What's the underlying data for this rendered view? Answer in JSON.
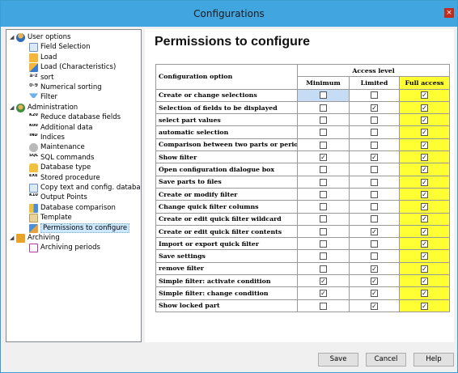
{
  "window": {
    "title": "Configurations",
    "close_label": "×"
  },
  "tree": {
    "items": [
      {
        "label": "User options",
        "icon": "user-icon",
        "cls": "user",
        "level": 1,
        "expander": "◢"
      },
      {
        "label": "Field Selection",
        "icon": "field-selection-icon",
        "cls": "grid",
        "level": 2
      },
      {
        "label": "Load",
        "icon": "load-icon",
        "cls": "load",
        "level": 2
      },
      {
        "label": "Load (Characteristics)",
        "icon": "load-characteristics-icon",
        "cls": "load2",
        "level": 2
      },
      {
        "label": "sort",
        "icon": "sort-icon",
        "cls": "sort",
        "level": 2,
        "glyph": "a-z"
      },
      {
        "label": "Numerical sorting",
        "icon": "numerical-sort-icon",
        "cls": "sort",
        "level": 2,
        "glyph": "0-9"
      },
      {
        "label": "Filter",
        "icon": "filter-icon",
        "cls": "filter",
        "level": 2
      },
      {
        "label": "Administration",
        "icon": "administration-icon",
        "cls": "admin",
        "level": 1,
        "expander": "◢"
      },
      {
        "label": "Reduce database fields",
        "icon": "reduce-fields-icon",
        "cls": "txt",
        "level": 2,
        "glyph": "K2011 K2111"
      },
      {
        "label": "Additional data",
        "icon": "additional-data-icon",
        "cls": "txt",
        "level": 2,
        "glyph": "K0009 K0011"
      },
      {
        "label": "Indices",
        "icon": "indices-icon",
        "cls": "txt",
        "level": 2,
        "glyph": "IND"
      },
      {
        "label": "Maintenance",
        "icon": "maintenance-icon",
        "cls": "maint",
        "level": 2
      },
      {
        "label": "SQL commands",
        "icon": "sql-icon",
        "cls": "txt",
        "level": 2,
        "glyph": "SQL"
      },
      {
        "label": "Database type",
        "icon": "database-type-icon",
        "cls": "db",
        "level": 2
      },
      {
        "label": "Stored procedure",
        "icon": "stored-procedure-icon",
        "cls": "txt",
        "level": 2,
        "glyph": "EXEC PROC"
      },
      {
        "label": "Copy text and config. database",
        "icon": "copy-text-icon",
        "cls": "grid",
        "level": 2
      },
      {
        "label": "Output Points",
        "icon": "output-points-icon",
        "cls": "txt",
        "level": 2,
        "glyph": "K1000 K2100"
      },
      {
        "label": "Database comparison",
        "icon": "database-comparison-icon",
        "cls": "dbcmp",
        "level": 2
      },
      {
        "label": "Template",
        "icon": "template-icon",
        "cls": "tmpl",
        "level": 2
      },
      {
        "label": "Permissions to configure",
        "icon": "permissions-icon",
        "cls": "perm",
        "level": 2,
        "selected": true
      },
      {
        "label": "Archiving",
        "icon": "archiving-icon",
        "cls": "archive",
        "level": 1,
        "expander": "◢"
      },
      {
        "label": "Archiving periods",
        "icon": "archiving-periods-icon",
        "cls": "period",
        "level": 2
      }
    ]
  },
  "main": {
    "title": "Permissions to configure",
    "table": {
      "col_option": "Configuration option",
      "col_access": "Access level",
      "sub_minimum": "Minimum",
      "sub_limited": "Limited",
      "sub_full": "Full access",
      "rows": [
        {
          "label": "Create or change selections",
          "min": false,
          "lim": false,
          "full": true
        },
        {
          "label": "Selection of fields to be displayed",
          "min": false,
          "lim": true,
          "full": true
        },
        {
          "label": "select part values",
          "min": false,
          "lim": false,
          "full": true
        },
        {
          "label": "automatic selection",
          "min": false,
          "lim": false,
          "full": true
        },
        {
          "label": "Comparison between two parts or periods",
          "min": false,
          "lim": false,
          "full": true
        },
        {
          "label": "Show filter",
          "min": true,
          "lim": true,
          "full": true
        },
        {
          "label": "Open configuration dialogue box",
          "min": false,
          "lim": false,
          "full": true
        },
        {
          "label": "Save parts to files",
          "min": false,
          "lim": false,
          "full": true
        },
        {
          "label": "Create or modify filter",
          "min": false,
          "lim": false,
          "full": true
        },
        {
          "label": "Change quick filter columns",
          "min": false,
          "lim": false,
          "full": true
        },
        {
          "label": "Create or edit quick filter wildcard",
          "min": false,
          "lim": false,
          "full": true
        },
        {
          "label": "Create or edit quick filter contents",
          "min": false,
          "lim": true,
          "full": true
        },
        {
          "label": "Import or export quick filter",
          "min": false,
          "lim": false,
          "full": true
        },
        {
          "label": "Save settings",
          "min": false,
          "lim": false,
          "full": true
        },
        {
          "label": "remove filter",
          "min": false,
          "lim": true,
          "full": true
        },
        {
          "label": "Simple filter: activate condition",
          "min": true,
          "lim": true,
          "full": true
        },
        {
          "label": "Simple filter: change condition",
          "min": true,
          "lim": true,
          "full": true
        },
        {
          "label": "Show locked part",
          "min": false,
          "lim": true,
          "full": true
        }
      ]
    }
  },
  "footer": {
    "save": "Save",
    "cancel": "Cancel",
    "help": "Help"
  },
  "colors": {
    "titlebar": "#41a5e0",
    "full_access": "#ffff33",
    "selection": "#cce8ff"
  }
}
